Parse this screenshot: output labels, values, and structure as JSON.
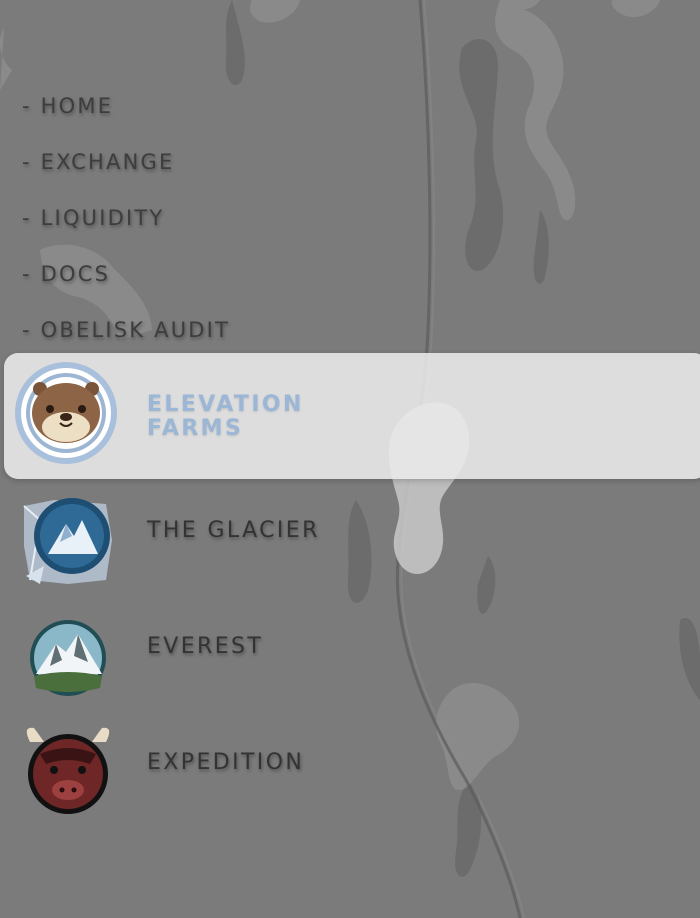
{
  "nav": {
    "items": [
      {
        "label": "- HOME"
      },
      {
        "label": "- EXCHANGE"
      },
      {
        "label": "- LIQUIDITY"
      },
      {
        "label": "- DOCS"
      },
      {
        "label": "- OBELISK AUDIT"
      }
    ]
  },
  "farms": [
    {
      "label_line1": "ELEVATION",
      "label_line2": "FARMS",
      "icon": "otter-icon",
      "active": true
    },
    {
      "label": "THE GLACIER",
      "icon": "glacier-icon"
    },
    {
      "label": "EVEREST",
      "icon": "everest-mountain-icon"
    },
    {
      "label": "EXPEDITION",
      "icon": "yak-icon"
    }
  ],
  "colors": {
    "background": "#7b7b7b",
    "active_label": "#9cb6d6",
    "text": "#3d3d3d",
    "highlight": "#ebebeb"
  }
}
